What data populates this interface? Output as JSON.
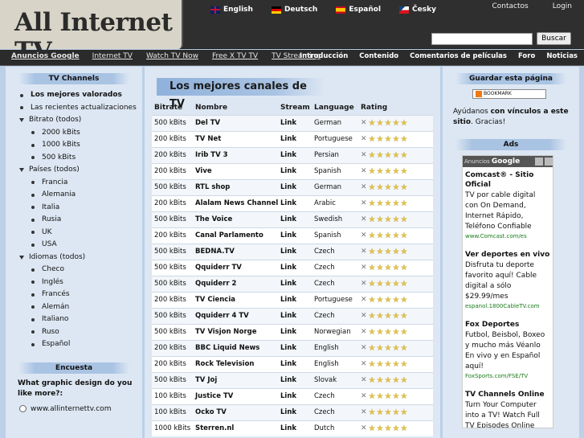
{
  "header": {
    "logo": "All Internet TV",
    "languages": [
      {
        "label": "English",
        "flag": "en"
      },
      {
        "label": "Deutsch",
        "flag": "de"
      },
      {
        "label": "Español",
        "flag": "es"
      },
      {
        "label": "Česky",
        "flag": "cz"
      }
    ],
    "links": [
      "Contactos",
      "Login"
    ],
    "search_button": "Buscar",
    "search_value": ""
  },
  "nav": {
    "left": [
      "Anuncios Google",
      "Internet TV",
      "Watch TV Now",
      "Free X TV TV",
      "TV Streaming"
    ],
    "right": [
      "Introducción",
      "Contenido",
      "Comentarios de películas",
      "Foro",
      "Noticias"
    ]
  },
  "sidebar": {
    "title": "TV Channels",
    "items": [
      {
        "label": "Los mejores valorados",
        "kind": "bullet",
        "bold": true,
        "sub": false
      },
      {
        "label": "Las recientes actualizaciones",
        "kind": "bullet",
        "bold": false,
        "sub": false
      },
      {
        "label": "Bitrato (todos)",
        "kind": "tri",
        "bold": false,
        "sub": false
      },
      {
        "label": "2000 kBits",
        "kind": "bullet",
        "bold": false,
        "sub": true
      },
      {
        "label": "1000 kBits",
        "kind": "bullet",
        "bold": false,
        "sub": true
      },
      {
        "label": "500 kBits",
        "kind": "bullet",
        "bold": false,
        "sub": true
      },
      {
        "label": "Países (todos)",
        "kind": "tri",
        "bold": false,
        "sub": false
      },
      {
        "label": "Francia",
        "kind": "bullet",
        "bold": false,
        "sub": true
      },
      {
        "label": "Alemania",
        "kind": "bullet",
        "bold": false,
        "sub": true
      },
      {
        "label": "Italia",
        "kind": "bullet",
        "bold": false,
        "sub": true
      },
      {
        "label": "Rusia",
        "kind": "bullet",
        "bold": false,
        "sub": true
      },
      {
        "label": "UK",
        "kind": "bullet",
        "bold": false,
        "sub": true
      },
      {
        "label": "USA",
        "kind": "bullet",
        "bold": false,
        "sub": true
      },
      {
        "label": "Idiomas (todos)",
        "kind": "tri",
        "bold": false,
        "sub": false
      },
      {
        "label": "Checo",
        "kind": "bullet",
        "bold": false,
        "sub": true
      },
      {
        "label": "Inglés",
        "kind": "bullet",
        "bold": false,
        "sub": true
      },
      {
        "label": "Francés",
        "kind": "bullet",
        "bold": false,
        "sub": true
      },
      {
        "label": "Alemán",
        "kind": "bullet",
        "bold": false,
        "sub": true
      },
      {
        "label": "Italiano",
        "kind": "bullet",
        "bold": false,
        "sub": true
      },
      {
        "label": "Ruso",
        "kind": "bullet",
        "bold": false,
        "sub": true
      },
      {
        "label": "Español",
        "kind": "bullet",
        "bold": false,
        "sub": true
      }
    ],
    "poll": {
      "title": "Encuesta",
      "question": "What graphic design do you like more?:",
      "option": "www.allinternettv.com"
    }
  },
  "main": {
    "title": "Los mejores canales de TV",
    "columns": [
      "Bitrate",
      "Nombre",
      "Stream",
      "Language",
      "Rating"
    ],
    "rows": [
      {
        "bitrate": "500 kBits",
        "name": "Del TV",
        "stream": "Link",
        "language": "German"
      },
      {
        "bitrate": "200 kBits",
        "name": "TV Net",
        "stream": "Link",
        "language": "Portuguese"
      },
      {
        "bitrate": "200 kBits",
        "name": "Irib TV 3",
        "stream": "Link",
        "language": "Persian"
      },
      {
        "bitrate": "200 kBits",
        "name": "Vive",
        "stream": "Link",
        "language": "Spanish"
      },
      {
        "bitrate": "500 kBits",
        "name": "RTL shop",
        "stream": "Link",
        "language": "German"
      },
      {
        "bitrate": "200 kBits",
        "name": "Alalam News Channel",
        "stream": "Link",
        "language": "Arabic"
      },
      {
        "bitrate": "500 kBits",
        "name": "The Voice",
        "stream": "Link",
        "language": "Swedish"
      },
      {
        "bitrate": "200 kBits",
        "name": "Canal Parlamento",
        "stream": "Link",
        "language": "Spanish"
      },
      {
        "bitrate": "500 kBits",
        "name": "BEDNA.TV",
        "stream": "Link",
        "language": "Czech"
      },
      {
        "bitrate": "500 kBits",
        "name": "Qquiderr TV",
        "stream": "Link",
        "language": "Czech"
      },
      {
        "bitrate": "500 kBits",
        "name": "Qquiderr 2",
        "stream": "Link",
        "language": "Czech"
      },
      {
        "bitrate": "200 kBits",
        "name": "TV Ciencia",
        "stream": "Link",
        "language": "Portuguese"
      },
      {
        "bitrate": "500 kBits",
        "name": "Qquiderr 4 TV",
        "stream": "Link",
        "language": "Czech"
      },
      {
        "bitrate": "500 kBits",
        "name": "TV Visjon Norge",
        "stream": "Link",
        "language": "Norwegian"
      },
      {
        "bitrate": "200 kBits",
        "name": "BBC Liquid News",
        "stream": "Link",
        "language": "English"
      },
      {
        "bitrate": "200 kBits",
        "name": "Rock Television",
        "stream": "Link",
        "language": "English"
      },
      {
        "bitrate": "500 kBits",
        "name": "TV Joj",
        "stream": "Link",
        "language": "Slovak"
      },
      {
        "bitrate": "100 kBits",
        "name": "Justice TV",
        "stream": "Link",
        "language": "Czech"
      },
      {
        "bitrate": "100 kBits",
        "name": "Ocko TV",
        "stream": "Link",
        "language": "Czech"
      },
      {
        "bitrate": "1000 kBits",
        "name": "Sterren.nl",
        "stream": "Link",
        "language": "Dutch"
      }
    ]
  },
  "right": {
    "save_title": "Guardar esta página",
    "bookmark": "BOOKMARK",
    "help_pre": "Ayúdanos ",
    "help_bold1": "con vínculos a este sitio",
    "help_post": ". Gracias!",
    "ads_title": "Ads",
    "ads_label": "Anuncios",
    "ads_brand": "Google",
    "ads": [
      {
        "title": "Comcast® - Sitio Oficial",
        "desc": "TV por cable digital con On Demand, Internet Rápido, Teléfono Confiable",
        "url": "www.Comcast.com/es"
      },
      {
        "title": "Ver deportes en vivo",
        "desc": "Disfruta tu deporte favorito aquí! Cable digital a sólo $29.99/mes",
        "url": "espanol.1800CableTV.com"
      },
      {
        "title": "Fox Deportes",
        "desc": "Futbol, Beisbol, Boxeo y mucho más Véanlo En vivo y en Español aquí!",
        "url": "FoxSports.com/FSE/TV"
      },
      {
        "title": "TV Channels Online",
        "desc": "Turn Your Computer into a TV! Watch Full TV Episodes Online",
        "url": ""
      }
    ]
  }
}
